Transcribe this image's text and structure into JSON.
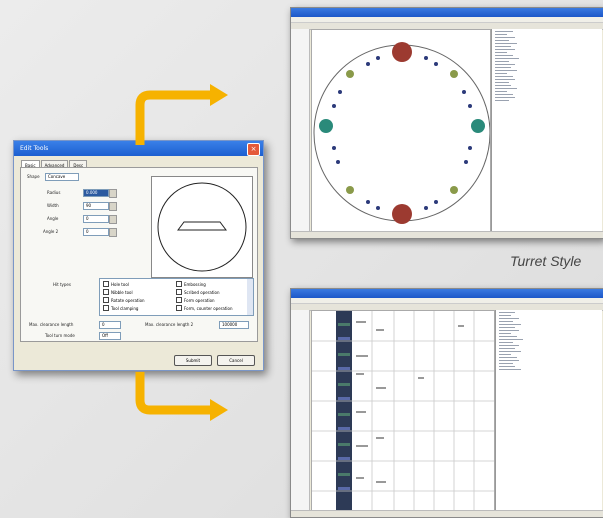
{
  "dialog": {
    "title": "Edit Tools",
    "tabs": [
      "Basic",
      "Advanced",
      "Desc"
    ],
    "shape_label": "Shape",
    "shape_value": "Concave",
    "fields": [
      {
        "label": "Radius",
        "value": "0.000"
      },
      {
        "label": "Width",
        "value": "90"
      },
      {
        "label": "Angle",
        "value": "0"
      },
      {
        "label": "Angle 2",
        "value": "0"
      }
    ],
    "options_label": "Hit types",
    "options": [
      "Hole tool",
      "Embossing",
      "Nibble tool",
      "Scribed operation",
      "Rotate operation",
      "Form operation",
      "Tool clamping",
      "Form, counter operation"
    ],
    "max_label": "Max. clearance length",
    "max_value": "0",
    "max2_label": "Max. clearance length 2",
    "max2_value": "100000",
    "tool_label": "Tool turn mode",
    "tool_value": "Off",
    "ok": "Submit",
    "cancel": "Cancel"
  },
  "caption": "Turret Style",
  "colors": {
    "arrow": "#f6b200",
    "red": "#9c3a30",
    "teal": "#2a8a7a",
    "olive": "#8a9a4a",
    "navy": "#2c3a7a"
  }
}
